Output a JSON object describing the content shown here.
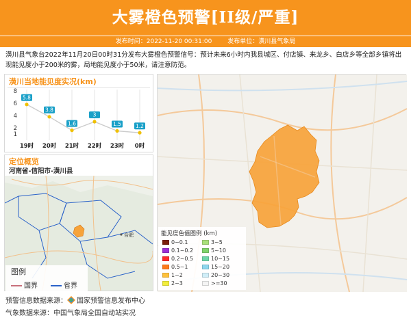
{
  "header": {
    "title": "大雾橙色预警[II级/严重]",
    "publish_label": "发布时间：2022-11-20 00:31:00",
    "unit_label": "发布单位：潢川县气象局"
  },
  "description": "潢川县气象台2022年11月20日00时31分发布大雾橙色预警信号：预计未来6小时内我县城区、付店镇、来龙乡、白店乡等全部乡镇将出现能见度小于200米的雾，局地能见度小于50米，请注意防范。",
  "visibility_panel": {
    "title": "潢川当地能见度实况(km)"
  },
  "chart_data": {
    "type": "line",
    "title": "潢川当地能见度实况(km)",
    "categories": [
      "19时",
      "20时",
      "21时",
      "22时",
      "23时",
      "0时"
    ],
    "values": [
      5.8,
      3.8,
      1.6,
      3,
      1.5,
      1.2
    ],
    "value_labels": [
      "5.8",
      "3.8",
      "1.6",
      "3",
      "1.5",
      "1.2"
    ],
    "y_ticks": [
      "8",
      "6",
      "4",
      "2",
      "1"
    ],
    "ylim": [
      0,
      8
    ],
    "line_color": "#cccccc",
    "point_color": "#f0c000",
    "label_bg": "#1aa0c8",
    "grid": "vertical"
  },
  "location_panel": {
    "title": "定位概览",
    "region": "河南省-信阳市-潢川县",
    "city_label": "合肥",
    "legend_title": "图例",
    "legend_items": [
      {
        "label": "国界",
        "color": "#c8707a"
      },
      {
        "label": "省界",
        "color": "#2a62c9"
      }
    ]
  },
  "map_legend": {
    "title": "能见度色值图例 (km)",
    "items": [
      {
        "label": "0~0.1",
        "color": "#7a1f0a"
      },
      {
        "label": "3~5",
        "color": "#a8e07a"
      },
      {
        "label": "0.1~0.2",
        "color": "#9b2fd6"
      },
      {
        "label": "5~10",
        "color": "#7fd36a"
      },
      {
        "label": "0.2~0.5",
        "color": "#ff2a2a"
      },
      {
        "label": "10~15",
        "color": "#6ed6a8"
      },
      {
        "label": "0.5~1",
        "color": "#ff7a1a"
      },
      {
        "label": "15~20",
        "color": "#8ed7ee"
      },
      {
        "label": "1~2",
        "color": "#ffc13b"
      },
      {
        "label": "20~30",
        "color": "#d0eef8"
      },
      {
        "label": "2~3",
        "color": "#f2ee3b"
      },
      {
        "label": ">=30",
        "color": "#f4f4f4"
      }
    ]
  },
  "colors": {
    "accent": "#f7941d",
    "fog_area": "#f7a33a"
  },
  "sources": {
    "warning_label": "预警信息数据来源：",
    "warning_value": "国家预警信息发布中心",
    "weather_label": "气象数据来源：",
    "weather_value": "中国气象局全国自动站实况"
  }
}
